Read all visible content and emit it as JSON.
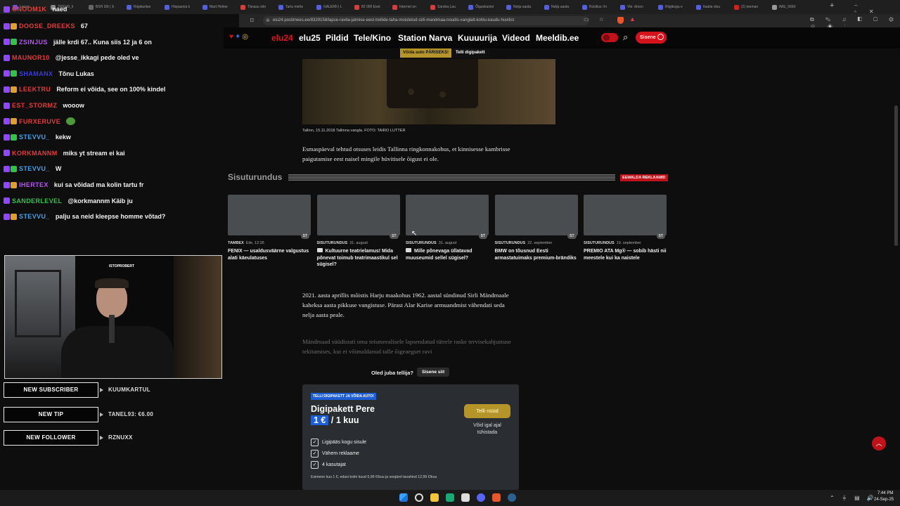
{
  "browser": {
    "tabs": [
      {
        "label": "Lause",
        "color": "#7a4dd9"
      },
      {
        "label": "TREUD_li",
        "color": "#888888"
      },
      {
        "label": "BSH 30t | S",
        "color": "#666666"
      },
      {
        "label": "Riigikantse",
        "color": "#5561d6"
      },
      {
        "label": "Hispaania k",
        "color": "#5561d6"
      },
      {
        "label": "Mart Helme",
        "color": "#5561d6"
      },
      {
        "label": "Tänasu sõn",
        "color": "#d04040"
      },
      {
        "label": "Tartu mehe",
        "color": "#5561d6"
      },
      {
        "label": "GALERII | L",
        "color": "#5561d6"
      },
      {
        "label": "82 000 Eest",
        "color": "#d04040"
      },
      {
        "label": "Internet on",
        "color": "#d04040"
      },
      {
        "label": "Sandra Lau",
        "color": "#d04040"
      },
      {
        "label": "Õiguskantsl",
        "color": "#5561d6"
      },
      {
        "label": "Nelja aasta",
        "color": "#5561d6"
      },
      {
        "label": "Nelja aasta",
        "color": "#5561d6"
      },
      {
        "label": "Küsitlus: Kr",
        "color": "#5561d6"
      },
      {
        "label": "Vle: droon",
        "color": "#5561d6"
      },
      {
        "label": "Riigikogu e",
        "color": "#5561d6"
      },
      {
        "label": "Itaalia otsu",
        "color": "#5561d6"
      },
      {
        "label": "(2) teeman",
        "color": "#d02020"
      },
      {
        "label": "IMG_5660",
        "color": "#999999"
      }
    ],
    "new_tab": "+",
    "url": "elu24.postimees.ee/8329158/lapse-ravita-jatmise-eest-trellide-taha-moistetud-sirli-mandmaa-noudis-vanglalt-kohtu-kaudu-huvitist"
  },
  "site": {
    "nav": [
      "elu24",
      "elu25",
      "Pildid",
      "Tele/Kino",
      "Station Narva",
      "Kuuuurija",
      "Videod",
      "Meeldib.ee"
    ],
    "login_label": "Sisene",
    "promo": {
      "left": "Võida auto PÄRISEKS!",
      "right": "Telli digipakett"
    }
  },
  "chat": [
    {
      "user": "GNOOM1K",
      "msg": "naed",
      "color": "#e0403a"
    },
    {
      "user": "DOOSE_DREEKS",
      "msg": "67",
      "color": "#e03c3c"
    },
    {
      "user": "ZSINJUS",
      "msg": "jälle krdi 67.. Kuna siis 12 ja 6 on",
      "color": "#b455f0"
    },
    {
      "user": "MAUNOR10",
      "msg": "@jesse_ikkagi pede oled ve",
      "color": "#e03c3c"
    },
    {
      "user": "SHAMANX",
      "msg": "Tõnu Lukas",
      "color": "#3b3bd6"
    },
    {
      "user": "LEEKTRU",
      "msg": "Reform ei võida, see on 100% kindel",
      "color": "#e03c3c"
    },
    {
      "user": "EST_STORMZ",
      "msg": "wooow",
      "color": "#e03c3c"
    },
    {
      "user": "FURXERUVE",
      "msg": "",
      "color": "#e03c3c"
    },
    {
      "user": "STEVVU_",
      "msg": "kekw",
      "color": "#4aa0e6"
    },
    {
      "user": "KORKMANNM",
      "msg": "miks yt stream ei kai",
      "color": "#e03c3c"
    },
    {
      "user": "STEVVU_",
      "msg": "W",
      "color": "#4aa0e6"
    },
    {
      "user": "IHERTEX",
      "msg": "kui sa võidad ma kolin tartu fr",
      "color": "#b455f0"
    },
    {
      "user": "SANDERLEVEL",
      "msg": "@korkmannm Käib ju",
      "color": "#31c24a"
    },
    {
      "user": "STEVVU_",
      "msg": "palju sa neid kleepse homme võtad?",
      "color": "#4aa0e6"
    }
  ],
  "webcam": {
    "tag": "ISTOPROBERT"
  },
  "alerts": [
    {
      "label": "NEW SUBSCRIBER",
      "value": "KUUMKARTUL"
    },
    {
      "label": "NEW TIP",
      "value": "TANEL93: €6.00"
    },
    {
      "label": "NEW FOLLOWER",
      "value": "RZNUXX"
    }
  ],
  "article": {
    "caption": "Tallinn, 15.11.2018 Tallinna vangla. FOTO: TAIRO LUTTER",
    "para1": "Esmaspäeval tehtud otsuses leidis Tallinna ringkonnakohus, et kinnisesse kambrisse paigutamise eest naisel mingile hüvitisele õigust ei ole.",
    "para2": "2021. aasta aprillis mõistis Harju maakohus 1962. aastal sündinud Sirli Mändmaale kaheksa aasta pikkuse vangistuse. Pärast Alar Karise armuandmist vähendati seda nelja aasta peale.",
    "para3": "Mändmaad süüdistati oma teismeealisele lapsendatud tütrele raske tervisekahjustuse tekitamises, kui ei võimaldanud talle õigeaegset ravi"
  },
  "sponsored": {
    "title": "Sisuturundus",
    "remove_ads": "EEMALDA REKLAAMID",
    "cards": [
      {
        "source": "TAMBEX",
        "date": "Eile, 12:26",
        "title": "FENIX — usaldusväärne valgustus alati käeulatuses",
        "camera": false
      },
      {
        "source": "SISUTURUNDUS",
        "date": "31. august",
        "title": "Kultuurne teatrielamus! Mida põnevat toimub teatrimaastikul sel sügisel?",
        "camera": true
      },
      {
        "source": "SISUTURUNDUS",
        "date": "31. august",
        "title": "Mille põnevaga üllatavad muuseumid sellel sügisel?",
        "camera": true
      },
      {
        "source": "SISUTURUNDUS",
        "date": "22. september",
        "title": "BMW on tõusnud Eesti armastatuimaks premium-brändiks",
        "camera": false
      },
      {
        "source": "SISUTURUNDUS",
        "date": "19. september",
        "title": "PREMIO ATA Mg® — sobib hästi nii meestele kui ka naistele",
        "camera": false
      }
    ],
    "badge": "ST"
  },
  "subscribe": {
    "prompt": "Oled juba tellija?",
    "login": "Sisene siit",
    "tag": "TELLI DIGIPAKETT JA VÕIDA AUTO!",
    "plan": "Digipakett Pere",
    "price_badge": "1 €",
    "price_rest": "/ 1 kuu",
    "cta": "Telli nüüd",
    "cancel_note": "Võid igal ajal tühistada",
    "features": [
      "Ligipääs kogu sisule",
      "Vähem reklaame",
      "4 kasutajat"
    ],
    "fineprint": "Esimene kuu 1 €, edasi kolm kuud 6,99 €/kuu ja seejärel tavahind 12,99 €/kuu"
  },
  "taskbar": {
    "time": "7:44 PM",
    "date": "24-Sep-25"
  },
  "colors": {
    "accent_red": "#d4121c",
    "gold": "#b5952a",
    "badge_blue": "#1f5fd6"
  }
}
